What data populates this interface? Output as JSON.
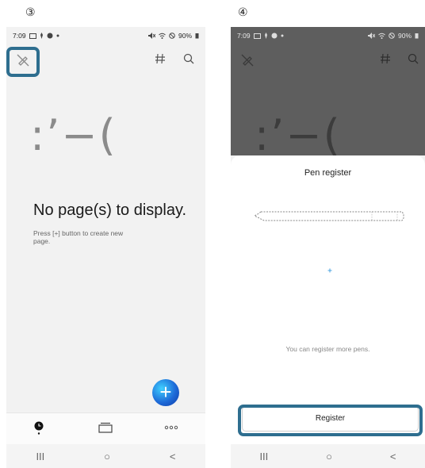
{
  "step3": "③",
  "step4": "④",
  "status": {
    "time": "7:09",
    "battery": "90%"
  },
  "screen3": {
    "emoticon": ":’−(",
    "empty_title": "No page(s) to display.",
    "empty_hint": "Press [+] button to create new page.",
    "fab_label": "+",
    "nav_buttons": [
      "III",
      "○",
      "<"
    ]
  },
  "screen4": {
    "dim_emoticon": ":’−(",
    "title": "Pen register",
    "hint": "You can register more pens.",
    "register_label": "Register",
    "nav_buttons": [
      "III",
      "○",
      "<"
    ]
  },
  "colors": {
    "highlight": "#2e6e8f",
    "dim": "#5e5e5e",
    "fab": "#1e6bd8"
  }
}
